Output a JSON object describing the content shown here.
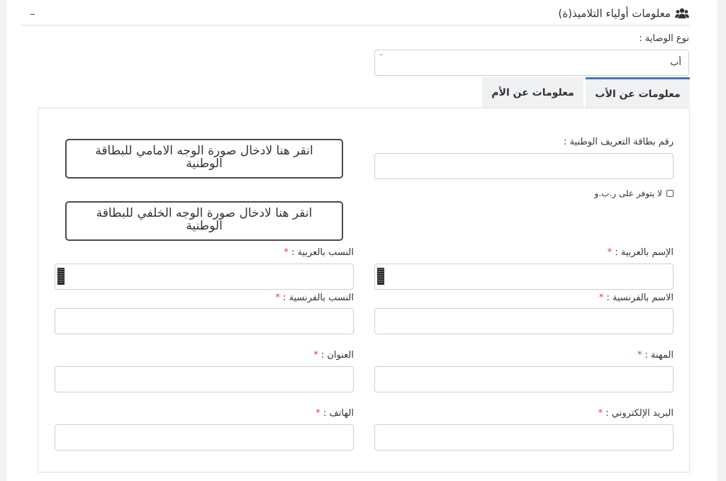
{
  "panel": {
    "title": "معلومات أولياء التلاميذ(ة)",
    "collapse": "–"
  },
  "guardianship": {
    "label": "نوع الوصاية :",
    "selected": "أب"
  },
  "tabs": [
    {
      "label": "معلومات عن الأب",
      "active": true
    },
    {
      "label": "معلومات عن الأم",
      "active": false
    }
  ],
  "form": {
    "national_id_label": "رقم بطاقة التعريف الوطنية :",
    "national_id_value": "",
    "no_id_checkbox_label": "لا يتوفر على ر.ب.و",
    "upload_front": "انقر هنا لادخال صورة الوجه الامامي للبطاقة الوطنية",
    "upload_back": "انقر هنا لادخال صورة الوجه الخلفي للبطاقة الوطنية",
    "first_name_ar_label": "الإسم بالعربية :",
    "last_name_ar_label": "النسب بالعربية :",
    "first_name_fr_label": "الاسم بالفرنسية :",
    "last_name_fr_label": "النسب بالفرنسية :",
    "profession_label": "المهنة :",
    "address_label": "العنوان :",
    "email_label": "البريد الإلكتروني :",
    "phone_label": "الهاتف :",
    "required_mark": "*"
  },
  "colors": {
    "tab_active_border": "#4a77a8",
    "required": "#e04040"
  }
}
